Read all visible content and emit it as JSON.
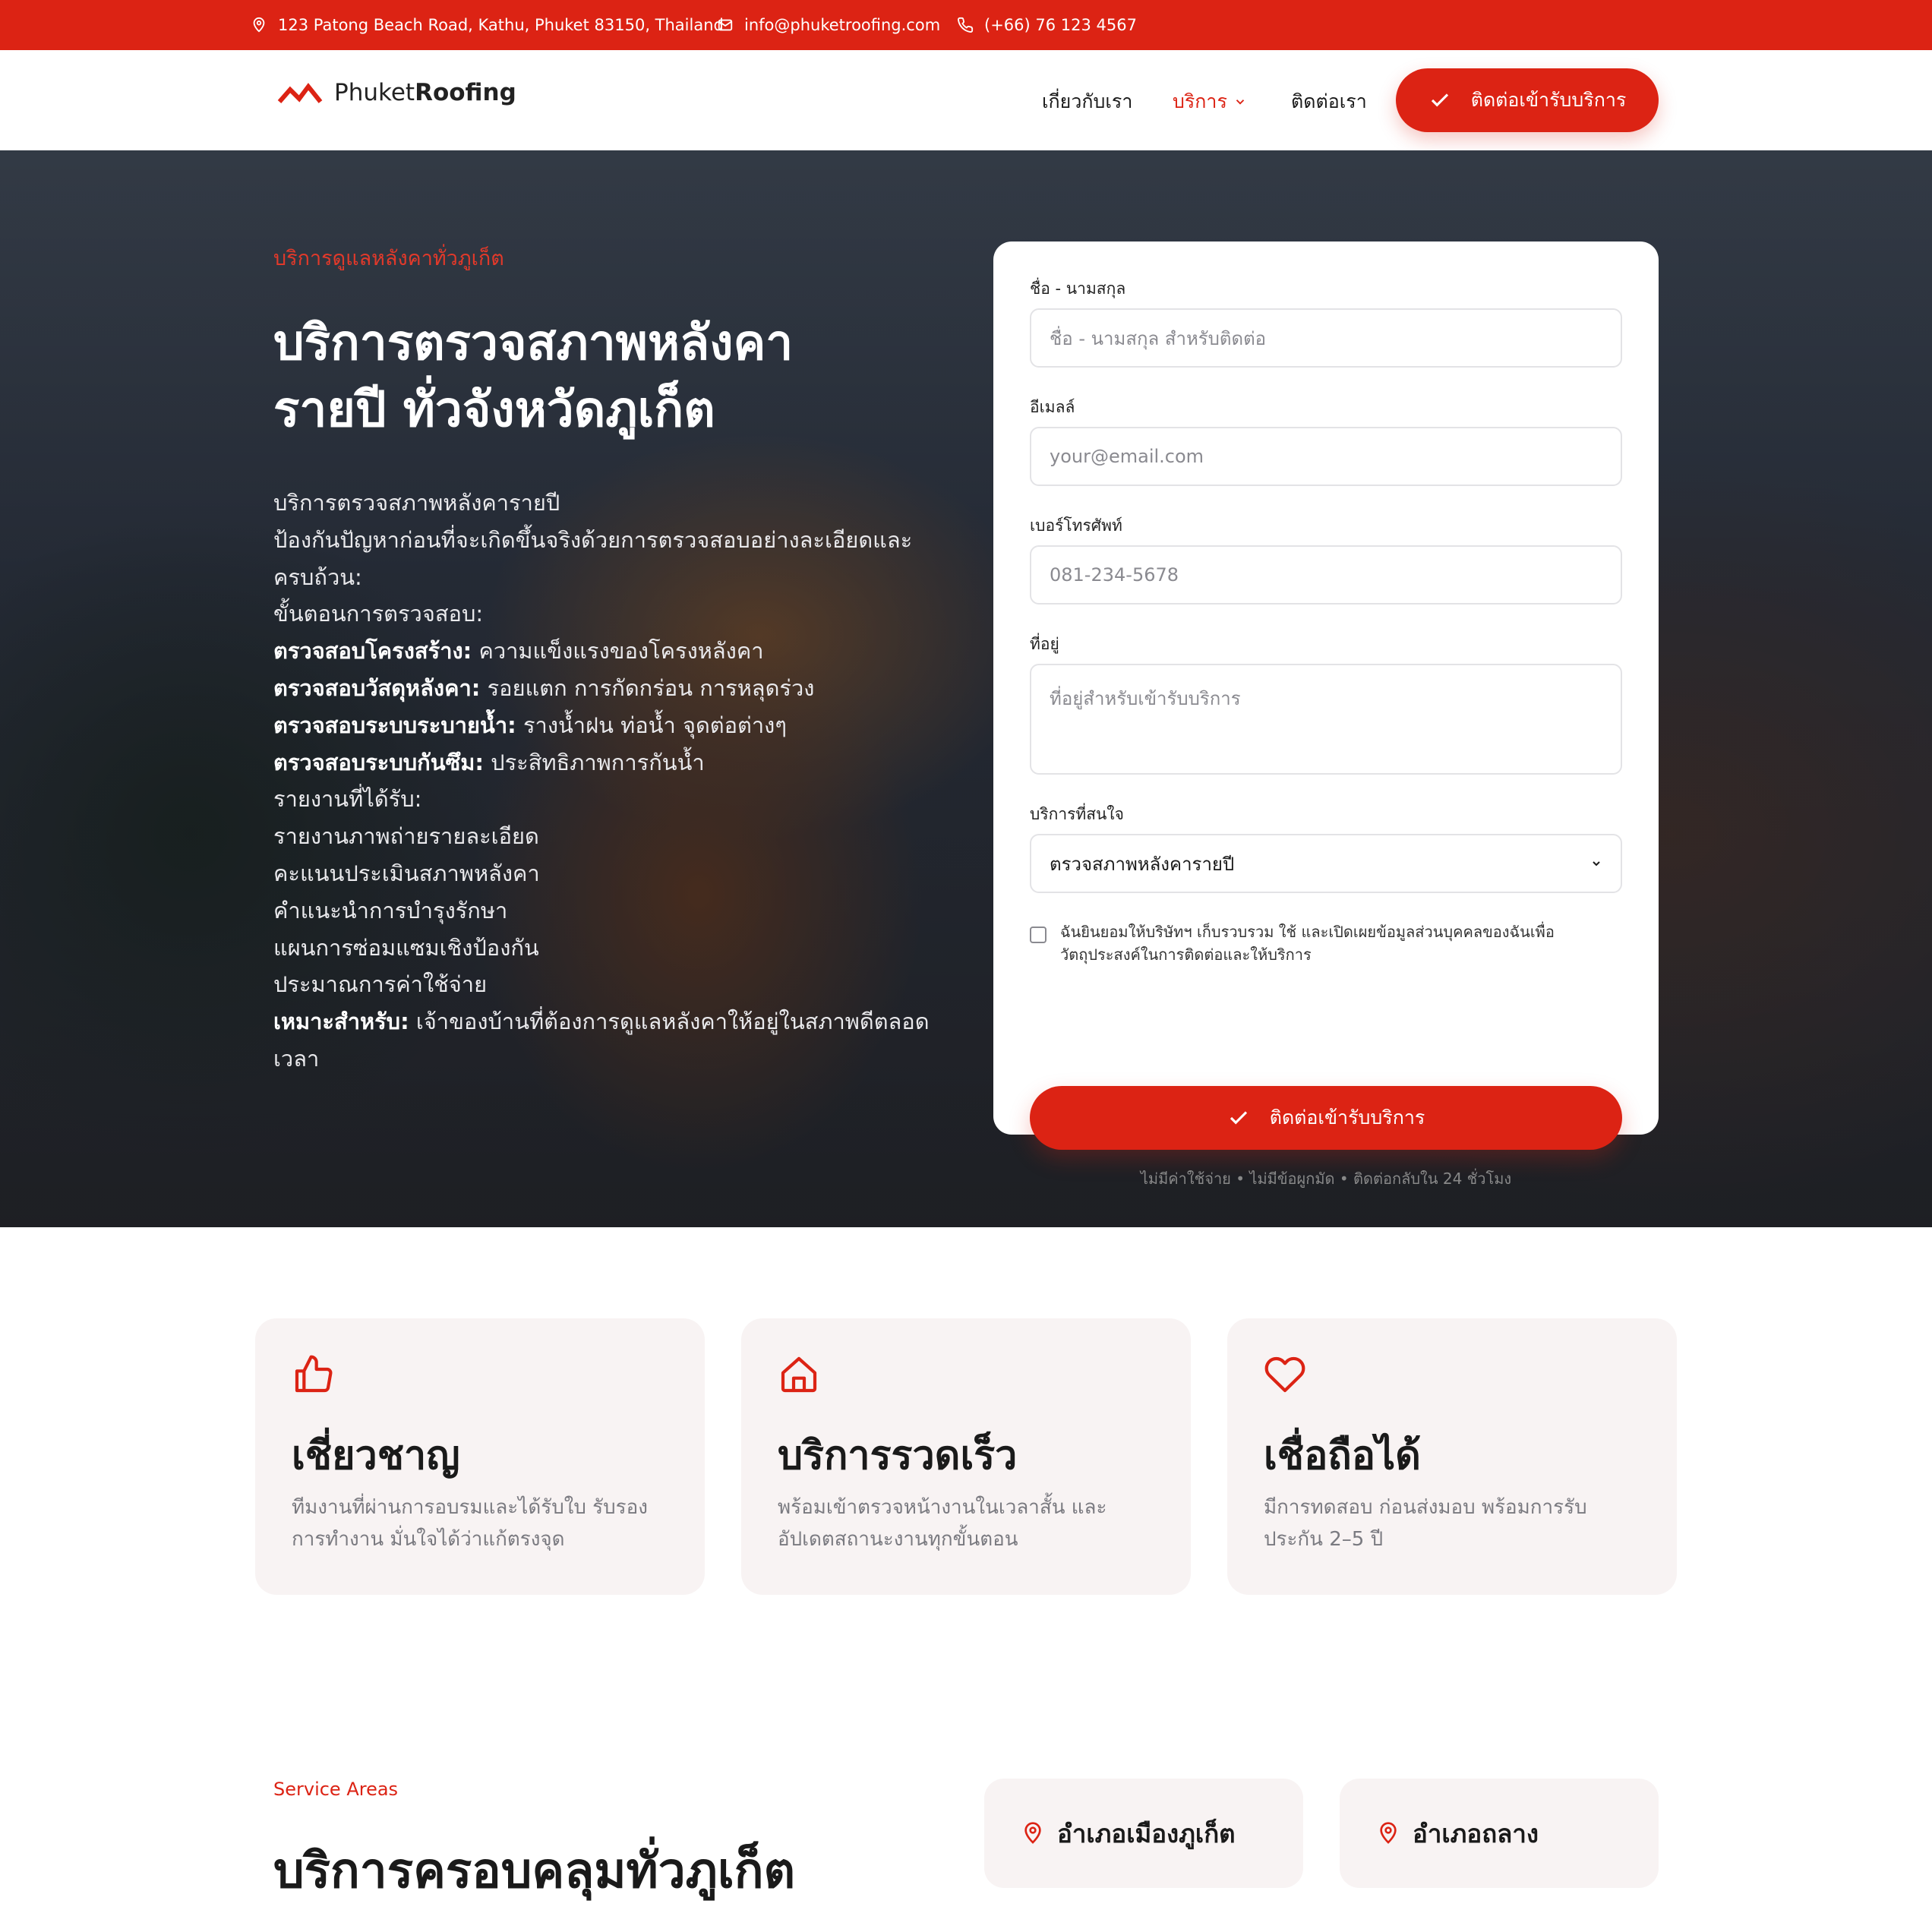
{
  "topbar": {
    "address": "123 Patong Beach Road, Kathu, Phuket 83150, Thailand",
    "email": "info@phuketroofing.com",
    "phone": "(+66) 76 123 4567"
  },
  "header": {
    "logo_regular": "Phuket",
    "logo_bold": "Roofing",
    "nav": {
      "about": "เกี่ยวกับเรา",
      "services": "บริการ",
      "contact": "ติดต่อเรา"
    },
    "cta_label": "ติดต่อเข้ารับบริการ"
  },
  "hero": {
    "eyebrow": "บริการดูแลหลังคาทั่วภูเก็ต",
    "title_line1": "บริการตรวจสภาพหลังคา",
    "title_line2": "รายปี ทั่วจังหวัดภูเก็ต",
    "intro": "บริการตรวจสภาพหลังคารายปี",
    "intro2": "ป้องกันปัญหาก่อนที่จะเกิดขึ้นจริงด้วยการตรวจสอบอย่างละเอียดและครบถ้วน:",
    "steps_heading": "ขั้นตอนการตรวจสอบ:",
    "steps": [
      {
        "bold": "ตรวจสอบโครงสร้าง:",
        "text": " ความแข็งแรงของโครงหลังคา"
      },
      {
        "bold": "ตรวจสอบวัสดุหลังคา:",
        "text": " รอยแตก การกัดกร่อน การหลุดร่วง"
      },
      {
        "bold": "ตรวจสอบระบบระบายน้ำ:",
        "text": " รางน้ำฝน ท่อน้ำ จุดต่อต่างๆ"
      },
      {
        "bold": "ตรวจสอบระบบกันซึม:",
        "text": " ประสิทธิภาพการกันน้ำ"
      }
    ],
    "report_heading": "รายงานที่ได้รับ:",
    "reports": [
      "รายงานภาพถ่ายรายละเอียด",
      "คะแนนประเมินสภาพหลังคา",
      "คำแนะนำการบำรุงรักษา",
      "แผนการซ่อมแซมเชิงป้องกัน",
      "ประมาณการค่าใช้จ่าย"
    ],
    "suitable_bold": "เหมาะสำหรับ:",
    "suitable_text": " เจ้าของบ้านที่ต้องการดูแลหลังคาให้อยู่ในสภาพดีตลอดเวลา"
  },
  "form": {
    "name_label": "ชื่อ - นามสกุล",
    "name_placeholder": "ชื่อ - นามสกุล สำหรับติดต่อ",
    "email_label": "อีเมลล์",
    "email_placeholder": "your@email.com",
    "phone_label": "เบอร์โทรศัพท์",
    "phone_placeholder": "081-234-5678",
    "address_label": "ที่อยู่",
    "address_placeholder": "ที่อยู่สำหรับเข้ารับบริการ",
    "service_label": "บริการที่สนใจ",
    "service_value": "ตรวจสภาพหลังคารายปี",
    "consent": "ฉันยินยอมให้บริษัทฯ เก็บรวบรวม ใช้ และเปิดเผยข้อมูลส่วนบุคคลของฉันเพื่อวัตถุประสงค์ในการติดต่อและให้บริการ",
    "submit_label": "ติดต่อเข้ารับบริการ",
    "disclaimer": "ไม่มีค่าใช้จ่าย • ไม่มีข้อผูกมัด • ติดต่อกลับใน 24 ชั่วโมง"
  },
  "features": [
    {
      "icon": "thumbs-up-icon",
      "title": "เชี่ยวชาญ",
      "text": "ทีมงานที่ผ่านการอบรมและได้รับใบ รับรองการทำงาน มั่นใจได้ว่าแก้ตรงจุด"
    },
    {
      "icon": "home-icon",
      "title": "บริการรวดเร็ว",
      "text": "พร้อมเข้าตรวจหน้างานในเวลาสั้น และอัปเดตสถานะงานทุกขั้นตอน"
    },
    {
      "icon": "heart-icon",
      "title": "เชื่อถือได้",
      "text": "มีการทดสอบ ก่อนส่งมอบ พร้อมการรับประกัน 2–5 ปี"
    }
  ],
  "service_areas": {
    "eyebrow": "Service Areas",
    "title": "บริการครอบคลุมทั่วภูเก็ต",
    "areas": [
      "อำเภอเมืองภูเก็ต",
      "อำเภอถลาง"
    ]
  },
  "colors": {
    "brand": "#dc2314",
    "card_bg": "#f8f3f3"
  }
}
